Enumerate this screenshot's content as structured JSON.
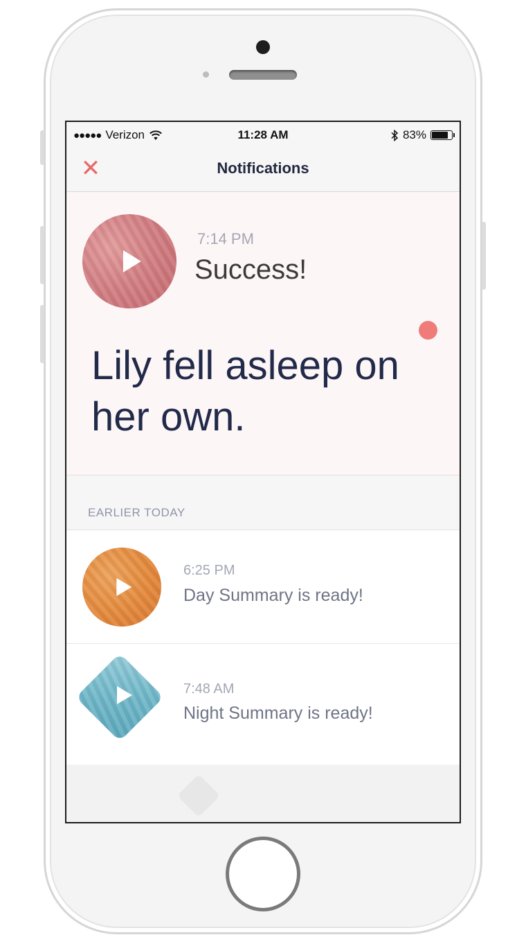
{
  "status_bar": {
    "signal": "●●●●●",
    "carrier": "Verizon",
    "time": "11:28 AM",
    "battery_percent": "83%",
    "battery_level": 0.83
  },
  "nav": {
    "close_icon": "✕",
    "title": "Notifications"
  },
  "hero": {
    "time": "7:14 PM",
    "label": "Success!",
    "message": "Lily fell asleep on her own.",
    "unread_color": "#ef7b7b"
  },
  "section": {
    "label": "EARLIER TODAY"
  },
  "notifications": [
    {
      "time": "6:25 PM",
      "text": "Day Summary is ready!",
      "thumb": "orange-circle"
    },
    {
      "time": "7:48 AM",
      "text": "Night Summary is ready!",
      "thumb": "blue-diamond"
    }
  ],
  "colors": {
    "accent": "#e86a6a",
    "title_text": "#222a3f",
    "hero_bg": "#fdf6f6"
  }
}
